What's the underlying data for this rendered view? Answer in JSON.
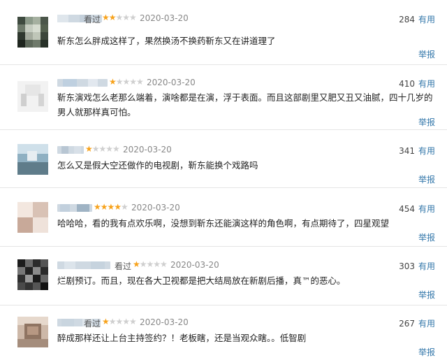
{
  "reviews": [
    {
      "status": "看过",
      "rating": 2,
      "stars": "★★★★★",
      "date": "2020-03-20",
      "votes": "284",
      "helpful_label": "有用",
      "content": "靳东怎么胖成这样了，果然换汤不换药靳东又在讲道理了",
      "report_label": "举报"
    },
    {
      "status": "",
      "rating": 1,
      "stars": "★★★★★",
      "date": "2020-03-20",
      "votes": "410",
      "helpful_label": "有用",
      "content": "靳东演戏怎么老那么端着，演啥都是在演，浮于表面。而且这部剧里又肥又丑又油腻，四十几岁的男人就那样真可怕。",
      "report_label": "举报"
    },
    {
      "status": "",
      "rating": 1,
      "stars": "★★★★★",
      "date": "2020-03-20",
      "votes": "341",
      "helpful_label": "有用",
      "content": "怎么又是假大空还做作的电视剧，靳东能换个戏路吗",
      "report_label": "举报"
    },
    {
      "status": "",
      "rating": 4,
      "stars": "★★★★★",
      "date": "2020-03-20",
      "votes": "454",
      "helpful_label": "有用",
      "content": "哈哈哈，看的我有点欢乐啊，没想到靳东还能演这样的角色啊，有点期待了，四星观望",
      "report_label": "举报"
    },
    {
      "status": "看过",
      "rating": 1,
      "stars": "★★★★★",
      "date": "2020-03-20",
      "votes": "303",
      "helpful_label": "有用",
      "content": "烂剧预订。而且，现在各大卫视都是把大结局放在新剧后播，真™的恶心。",
      "report_label": "举报"
    },
    {
      "status": "看过",
      "rating": 1,
      "stars": "★★★★★",
      "date": "2020-03-20",
      "votes": "267",
      "helpful_label": "有用",
      "content": "醉成那样还让上台主持签约？！老板瞎，还是当观众瞎。。低智剧",
      "report_label": "举报"
    }
  ],
  "colors": {
    "star_on": "#f7a21b",
    "star_off": "#cfcfcf",
    "link": "#3377aa",
    "divider": "#e5e5e5"
  }
}
